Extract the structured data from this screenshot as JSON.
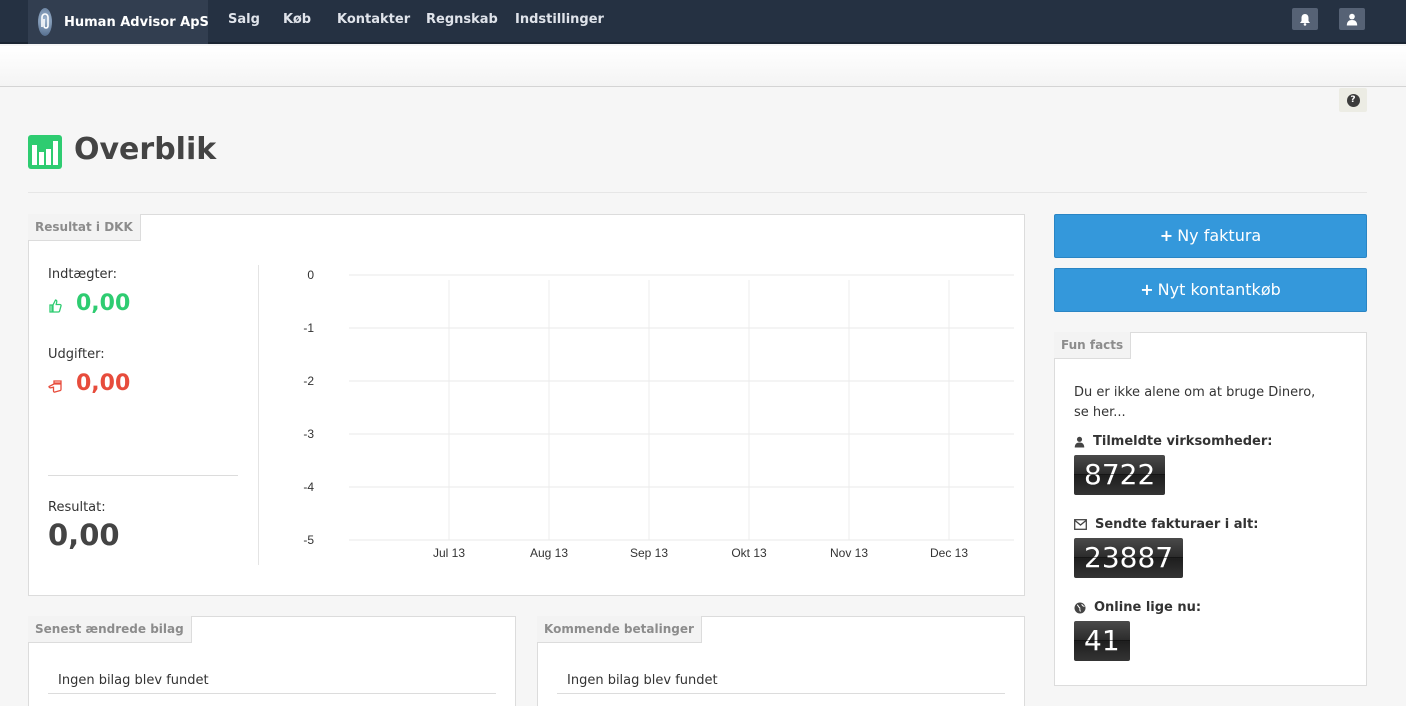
{
  "navbar": {
    "company": "Human Advisor ApS",
    "items": [
      {
        "label": "Salg"
      },
      {
        "label": "Køb"
      },
      {
        "label": "Kontakter"
      },
      {
        "label": "Regnskab"
      },
      {
        "label": "Indstillinger"
      }
    ]
  },
  "page": {
    "title": "Overblik",
    "help_icon": "?"
  },
  "result_panel": {
    "tab": "Resultat i DKK",
    "income_label": "Indtægter:",
    "income_value": "0,00",
    "expenses_label": "Udgifter:",
    "expenses_value": "0,00",
    "result_label": "Resultat:",
    "result_value": "0,00"
  },
  "chart_data": {
    "type": "line",
    "categories": [
      "Jul 13",
      "Aug 13",
      "Sep 13",
      "Okt 13",
      "Nov 13",
      "Dec 13"
    ],
    "series": [],
    "ylim": [
      -5,
      0
    ],
    "yticks": [
      "0",
      "-1",
      "-2",
      "-3",
      "-4",
      "-5"
    ],
    "grid": true
  },
  "actions": {
    "new_invoice": "Ny faktura",
    "new_cash_purchase": "Nyt kontantkøb"
  },
  "fun_facts": {
    "tab": "Fun facts",
    "intro": "Du er ikke alene om at bruge Dinero, se her...",
    "companies_label": "Tilmeldte virksomheder:",
    "companies_value": "8722",
    "invoices_label": "Sendte fakturaer i alt:",
    "invoices_value": "23887",
    "online_label": "Online lige nu:",
    "online_value": "41"
  },
  "recent_panel": {
    "tab": "Senest ændrede bilag",
    "empty": "Ingen bilag blev fundet"
  },
  "payments_panel": {
    "tab": "Kommende betalinger",
    "empty": "Ingen bilag blev fundet"
  },
  "colors": {
    "nav_bg": "#253142",
    "primary": "#3498db",
    "income": "#2ecc71",
    "expense": "#e74c3c"
  }
}
